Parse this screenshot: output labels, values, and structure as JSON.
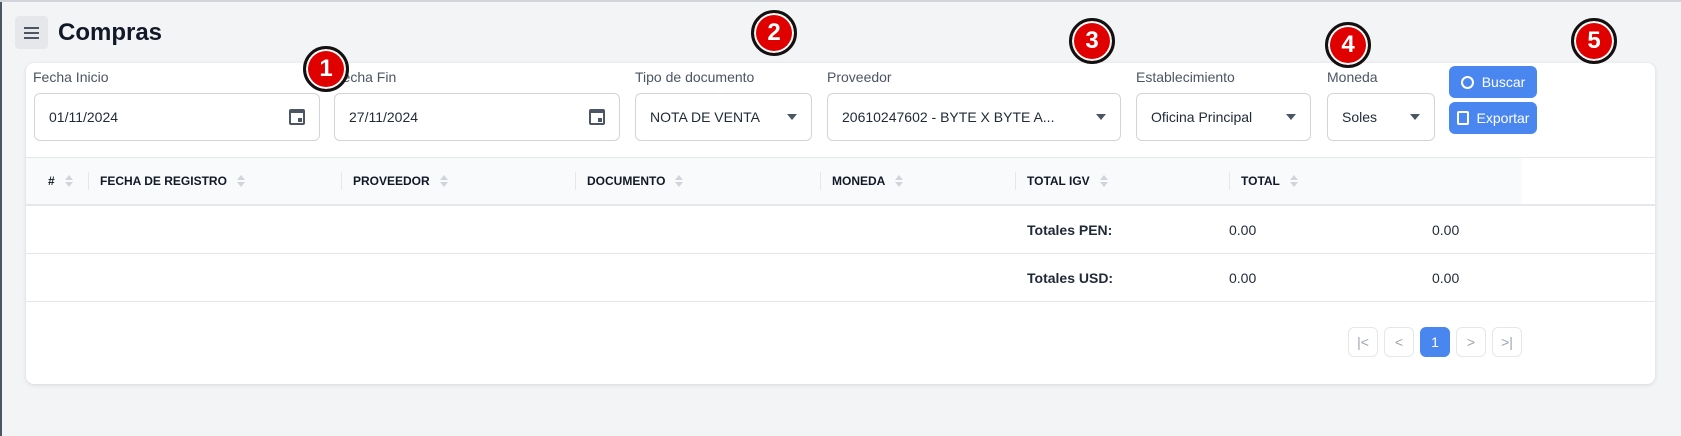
{
  "header": {
    "title": "Compras",
    "menu_icon": "hamburger-icon"
  },
  "filters": {
    "fecha_inicio": {
      "label": "Fecha Inicio",
      "value": "01/11/2024"
    },
    "fecha_fin": {
      "label": "Fecha Fin",
      "value": "27/11/2024"
    },
    "tipo_documento": {
      "label": "Tipo de documento",
      "value": "NOTA DE VENTA"
    },
    "proveedor": {
      "label": "Proveedor",
      "value": "20610247602 - BYTE X BYTE A..."
    },
    "establecimiento": {
      "label": "Establecimiento",
      "value": "Oficina Principal"
    },
    "moneda": {
      "label": "Moneda",
      "value": "Soles"
    }
  },
  "actions": {
    "buscar": "Buscar",
    "exportar": "Exportar"
  },
  "badges": [
    "1",
    "2",
    "3",
    "4",
    "5"
  ],
  "table": {
    "columns": [
      "#",
      "FECHA DE REGISTRO",
      "PROVEEDOR",
      "DOCUMENTO",
      "MONEDA",
      "TOTAL IGV",
      "TOTAL"
    ],
    "totals": [
      {
        "label": "Totales PEN:",
        "igv": "0.00",
        "total": "0.00"
      },
      {
        "label": "Totales USD:",
        "igv": "0.00",
        "total": "0.00"
      }
    ]
  },
  "pagination": {
    "first": "|<",
    "prev": "<",
    "current": "1",
    "next": ">",
    "last": ">|"
  },
  "colors": {
    "accent": "#4a86f0",
    "badge": "#e00000"
  }
}
